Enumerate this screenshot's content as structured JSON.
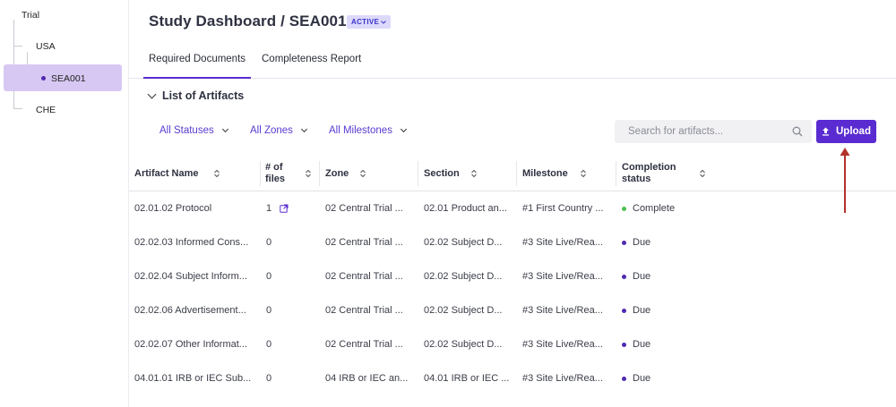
{
  "sidebar": {
    "items": [
      {
        "label": "Trial"
      },
      {
        "label": "USA"
      },
      {
        "label": "SEA001"
      },
      {
        "label": "CHE"
      }
    ]
  },
  "header": {
    "title": "Study Dashboard / SEA001",
    "badge": "ACTIVE"
  },
  "tabs": [
    {
      "label": "Required Documents",
      "active": true
    },
    {
      "label": "Completeness Report",
      "active": false
    }
  ],
  "section": {
    "title": "List of Artifacts"
  },
  "filters": [
    {
      "label": "All Statuses"
    },
    {
      "label": "All Zones"
    },
    {
      "label": "All Milestones"
    }
  ],
  "search": {
    "placeholder": "Search for artifacts...",
    "value": ""
  },
  "upload": {
    "label": "Upload"
  },
  "table": {
    "columns": [
      {
        "label": "Artifact Name"
      },
      {
        "label": "# of files"
      },
      {
        "label": "Zone"
      },
      {
        "label": "Section"
      },
      {
        "label": "Milestone"
      },
      {
        "label": "Completion status"
      }
    ],
    "rows": [
      {
        "name": "02.01.02 Protocol",
        "files": "1",
        "zone": "02 Central Trial ...",
        "section": "02.01 Product an...",
        "milestone": "#1 First Country ...",
        "status": "Complete"
      },
      {
        "name": "02.02.03 Informed Cons...",
        "files": "0",
        "zone": "02 Central Trial ...",
        "section": "02.02 Subject D...",
        "milestone": "#3 Site Live/Rea...",
        "status": "Due"
      },
      {
        "name": "02.02.04 Subject Inform...",
        "files": "0",
        "zone": "02 Central Trial ...",
        "section": "02.02 Subject D...",
        "milestone": "#3 Site Live/Rea...",
        "status": "Due"
      },
      {
        "name": "02.02.06 Advertisement...",
        "files": "0",
        "zone": "02 Central Trial ...",
        "section": "02.02 Subject D...",
        "milestone": "#3 Site Live/Rea...",
        "status": "Due"
      },
      {
        "name": "02.02.07 Other Informat...",
        "files": "0",
        "zone": "02 Central Trial ...",
        "section": "02.02 Subject D...",
        "milestone": "#3 Site Live/Rea...",
        "status": "Due"
      },
      {
        "name": "04.01.01 IRB or IEC Sub...",
        "files": "0",
        "zone": "04 IRB or IEC an...",
        "section": "04.01 IRB or IEC ...",
        "milestone": "#3 Site Live/Rea...",
        "status": "Due"
      }
    ]
  },
  "colors": {
    "accent": "#5a2bd0",
    "complete": "#4cc04f",
    "due": "#4f2ab0",
    "annotation_arrow": "#b2312a"
  },
  "icons": [
    "search-icon",
    "upload-icon",
    "external-link-icon",
    "sort-icon",
    "chevron-down-icon"
  ]
}
